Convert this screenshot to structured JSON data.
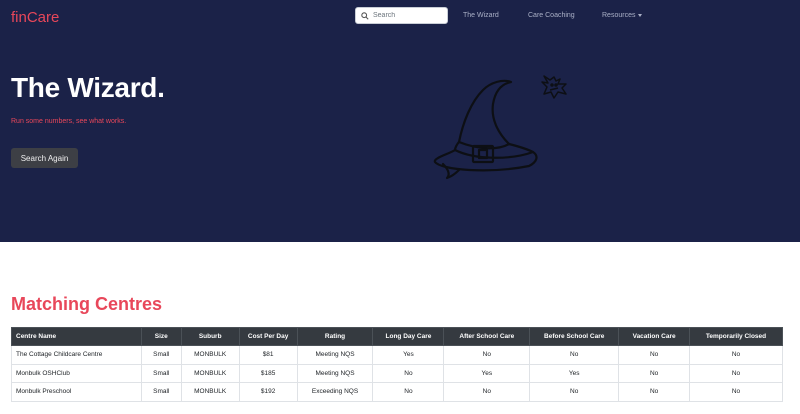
{
  "brand": "finCare",
  "search": {
    "placeholder": "Search"
  },
  "nav": {
    "wizard": "The Wizard",
    "coaching": "Care Coaching",
    "resources": "Resources"
  },
  "hero": {
    "title": "The Wizard.",
    "subtitle": "Run some numbers, see what works.",
    "button": "Search Again"
  },
  "section": {
    "title": "Matching Centres"
  },
  "table": {
    "headers": [
      "Centre Name",
      "Size",
      "Suburb",
      "Cost Per Day",
      "Rating",
      "Long Day Care",
      "After School Care",
      "Before School Care",
      "Vacation Care",
      "Temporarily Closed"
    ],
    "rows": [
      [
        "The Cottage Childcare Centre",
        "Small",
        "MONBULK",
        "$81",
        "Meeting NQS",
        "Yes",
        "No",
        "No",
        "No",
        "No"
      ],
      [
        "Monbulk OSHClub",
        "Small",
        "MONBULK",
        "$185",
        "Meeting NQS",
        "No",
        "Yes",
        "Yes",
        "No",
        "No"
      ],
      [
        "Monbulk Preschool",
        "Small",
        "MONBULK",
        "$192",
        "Exceeding NQS",
        "No",
        "No",
        "No",
        "No",
        "No"
      ]
    ]
  },
  "colors": {
    "hero_bg": "#1b2248",
    "accent": "#e8475a",
    "table_header_bg": "#353a40",
    "button_bg": "#3d3f45"
  },
  "icons": {
    "search": "search-icon",
    "hat": "wizard-hat-icon",
    "bat": "bat-icon",
    "caret": "caret-down-icon"
  }
}
